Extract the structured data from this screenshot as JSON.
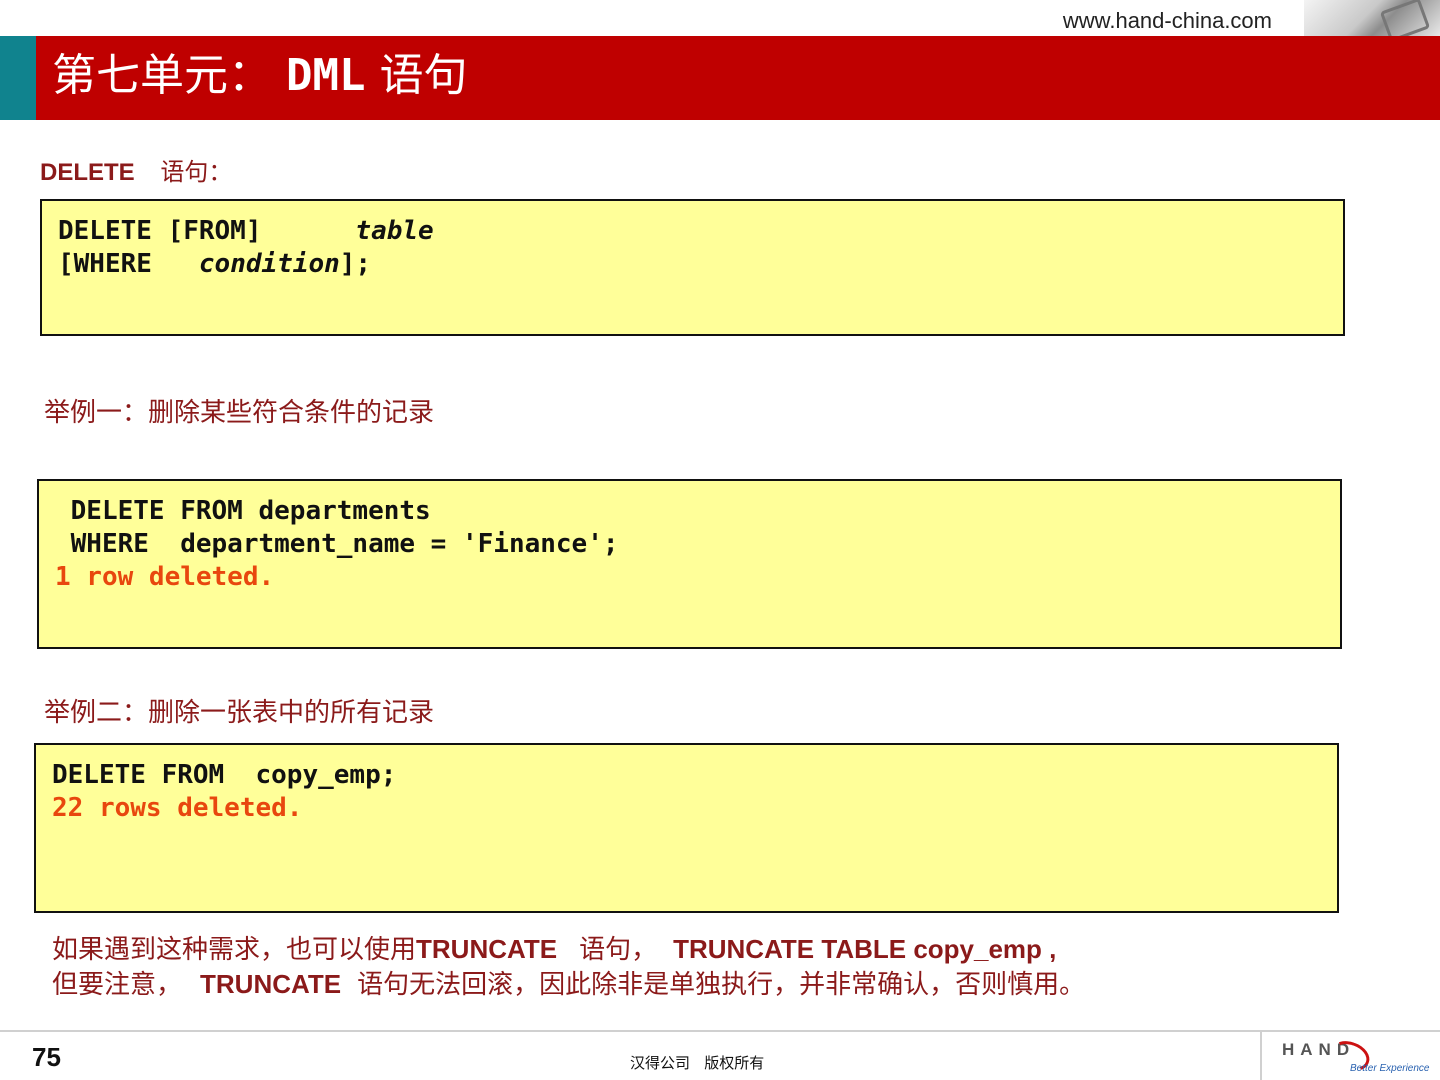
{
  "header": {
    "url": "www.hand-china.com",
    "title_prefix": "第七单元：",
    "title_keyword": "DML",
    "title_suffix": "语句"
  },
  "section": {
    "keyword": "DELETE",
    "suffix": "语句："
  },
  "syntax_box": {
    "line1_a": "DELETE [FROM]      ",
    "line1_b": "table",
    "line2_a": "[WHERE   ",
    "line2_b": "condition",
    "line2_c": "];"
  },
  "example1": {
    "label": "举例一：删除某些符合条件的记录",
    "line1": " DELETE FROM departments",
    "line2": " WHERE  department_name = 'Finance';",
    "result": "1 row deleted."
  },
  "example2": {
    "label": "举例二：删除一张表中的所有记录",
    "line1": "DELETE FROM  copy_emp;",
    "result": "22 rows deleted."
  },
  "note": {
    "l1_a": "如果遇到这种需求，也可以使用",
    "l1_b": "TRUNCATE",
    "l1_c": "语句，",
    "l1_d": "TRUNCATE  TABLE copy_emp ,",
    "l2_a": "但要注意，",
    "l2_b": "TRUNCATE",
    "l2_c": "语句无法回滚，因此除非是单独执行，并非常确认，否则慎用。"
  },
  "footer": {
    "page_number": "75",
    "copyright": "汉得公司   版权所有",
    "logo_text": "HAND",
    "logo_tagline": "Better Experience"
  },
  "colors": {
    "banner": "#bf0000",
    "accent_teal": "#10838e",
    "code_background": "#ffff99",
    "output_text": "#e8470e",
    "label_text": "#8b1a1a"
  }
}
